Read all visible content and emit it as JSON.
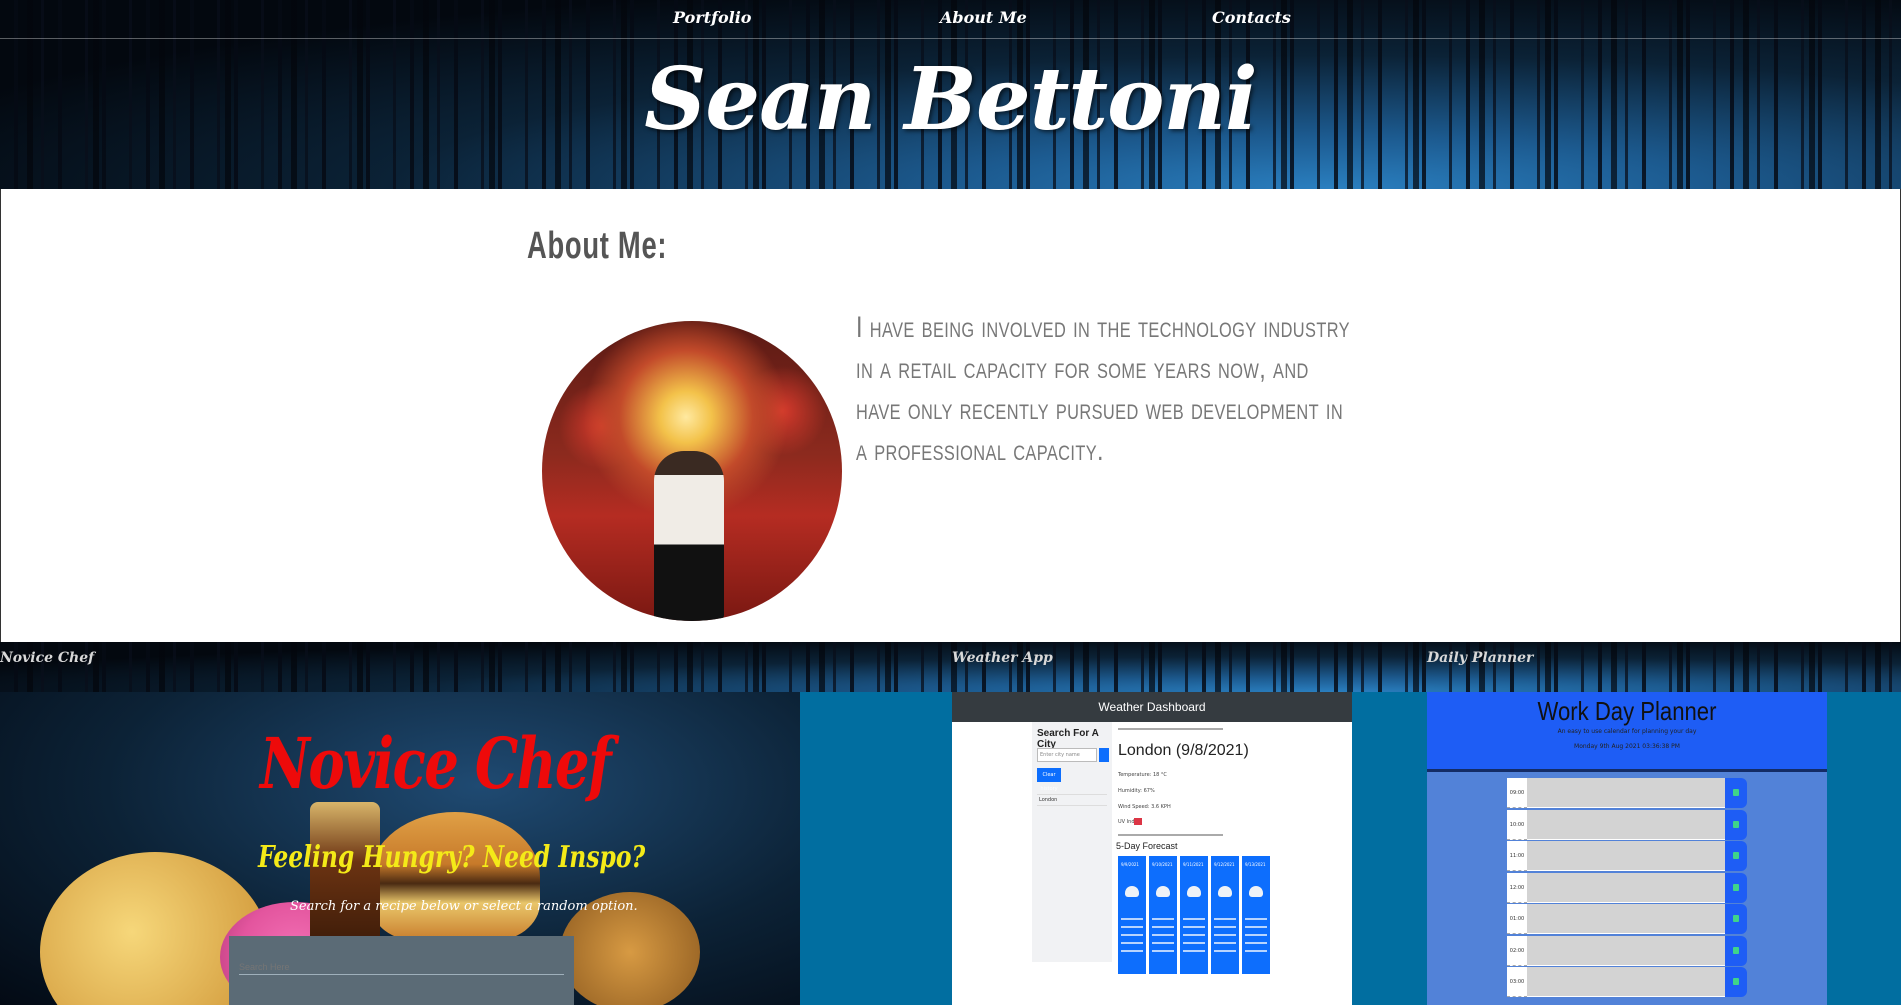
{
  "nav": {
    "links": [
      {
        "label": "Portfolio"
      },
      {
        "label": "About Me"
      },
      {
        "label": "Contacts"
      }
    ]
  },
  "header": {
    "title": "Sean Bettoni"
  },
  "about": {
    "heading": "About Me:",
    "text": "I have being involved in the technology industry in a retail capacity for some years now, and have only recently pursued web development in a professional capacity."
  },
  "portfolio": {
    "projects": [
      {
        "label": "Novice Chef",
        "title": "Novice Chef",
        "subtitle": "Feeling Hungry? Need Inspo?",
        "description": "Search for a recipe below or select a random option.",
        "search_placeholder": "Search Here"
      },
      {
        "label": "Weather App",
        "bar_title": "Weather Dashboard",
        "sidebar_title": "Search For A City",
        "sidebar_input_placeholder": "Enter city name",
        "clear_button": "Clear history",
        "history_city": "London",
        "city_heading": "London (9/8/2021)",
        "stats": [
          "Temperature: 18 °C",
          "Humidity: 67%",
          "Wind Speed: 3.6 KPH",
          "UV Index:"
        ],
        "forecast_title": "5-Day Forecast",
        "forecast_days": [
          "9/9/2021",
          "9/10/2021",
          "9/11/2021",
          "9/12/2021",
          "9/13/2021"
        ]
      },
      {
        "label": "Daily Planner",
        "title": "Work Day Planner",
        "subtitle": "An easy to use calendar for planning your day",
        "date": "Monday 9th Aug 2021 03:36:38 PM",
        "hours": [
          "09:00 am",
          "10:00 am",
          "11:00 am",
          "12:00 pm",
          "01:00 pm",
          "02:00 pm",
          "03:00 pm"
        ]
      }
    ]
  },
  "colors": {
    "portfolio_bg": "#016ea0",
    "novice_title": "#ee0a0a",
    "novice_subtitle": "#f4ea18",
    "planner_header": "#1e5df5",
    "weather_accent": "#0d6efd"
  }
}
